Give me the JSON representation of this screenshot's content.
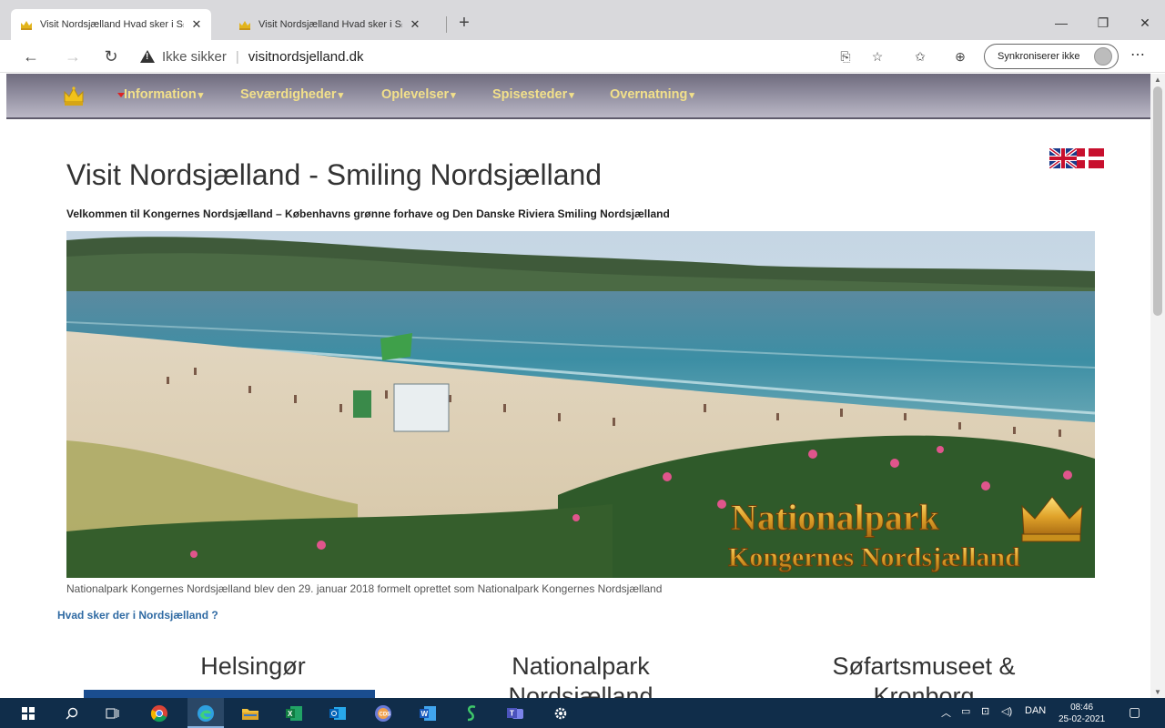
{
  "browser": {
    "tabs": [
      {
        "title": "Visit Nordsjælland Hvad sker i Sø",
        "active": true
      },
      {
        "title": "Visit Nordsjælland Hvad sker i Sø",
        "active": false
      }
    ],
    "new_tab": "+",
    "not_secure": "Ikke sikker",
    "url": "visitnordsjelland.dk",
    "sync_label": "Synkroniserer ikke"
  },
  "site": {
    "nav": [
      {
        "label": "Information"
      },
      {
        "label": "Seværdigheder"
      },
      {
        "label": "Oplevelser"
      },
      {
        "label": "Spisesteder"
      },
      {
        "label": "Overnatning"
      }
    ],
    "title": "Visit Nordsjælland - Smiling Nordsjælland",
    "subtitle": "Velkommen til Kongernes Nordsjælland – Københavns grønne forhave og Den Danske Riviera Smiling Nordsjælland",
    "hero_text_line1": "Nationalpark",
    "hero_text_line2": "Kongernes Nordsjælland",
    "caption": "Nationalpark Kongernes Nordsjælland blev den 29. januar 2018 formelt oprettet som Nationalpark Kongernes Nordsjælland",
    "link": "Hvad sker der i Nordsjælland ?",
    "columns": [
      {
        "title": "Helsingør"
      },
      {
        "title": "Nationalpark Nordsjælland"
      },
      {
        "title": "Søfartsmuseet & Kronborg"
      }
    ]
  },
  "taskbar": {
    "language": "DAN",
    "time": "08:46",
    "date": "25-02-2021"
  },
  "colors": {
    "nav_text": "#f2e08a",
    "link": "#2f6aa3",
    "taskbar": "#102d4a"
  }
}
